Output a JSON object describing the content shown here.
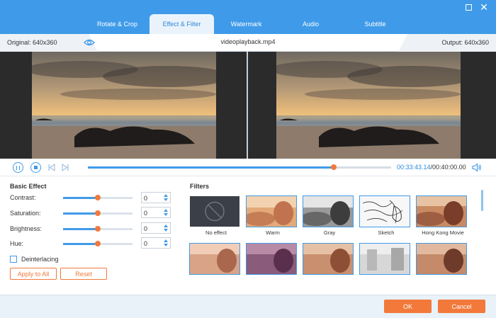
{
  "tabs": [
    {
      "label": "Rotate & Crop",
      "active": false
    },
    {
      "label": "Effect & Filter",
      "active": true
    },
    {
      "label": "Watermark",
      "active": false
    },
    {
      "label": "Audio",
      "active": false
    },
    {
      "label": "Subtitle",
      "active": false
    }
  ],
  "infobar": {
    "original": "Original: 640x360",
    "filename": "videoplayback.mp4",
    "output": "Output: 640x360"
  },
  "playback": {
    "current": "00:33:43.14",
    "total": "/00:40:00.00",
    "progress_fraction": 0.811
  },
  "basic_effect": {
    "title": "Basic Effect",
    "rows": [
      {
        "label": "Contrast:",
        "value": "0",
        "level": 0.5
      },
      {
        "label": "Saturation:",
        "value": "0",
        "level": 0.5
      },
      {
        "label": "Brightness:",
        "value": "0",
        "level": 0.5
      },
      {
        "label": "Hue:",
        "value": "0",
        "level": 0.5
      }
    ],
    "deinterlacing": "Deinterlacing",
    "apply_label": "Apply to All",
    "reset_label": "Reset"
  },
  "filters": {
    "title": "Filters",
    "items": [
      {
        "label": "No effect"
      },
      {
        "label": "Warm"
      },
      {
        "label": "Gray"
      },
      {
        "label": "Sketch"
      },
      {
        "label": "Hong Kong Movie"
      }
    ]
  },
  "footer": {
    "ok_label": "OK",
    "cancel_label": "Cancel"
  },
  "colors": {
    "accent_blue": "#3f9be9",
    "accent_orange": "#f2793a"
  }
}
